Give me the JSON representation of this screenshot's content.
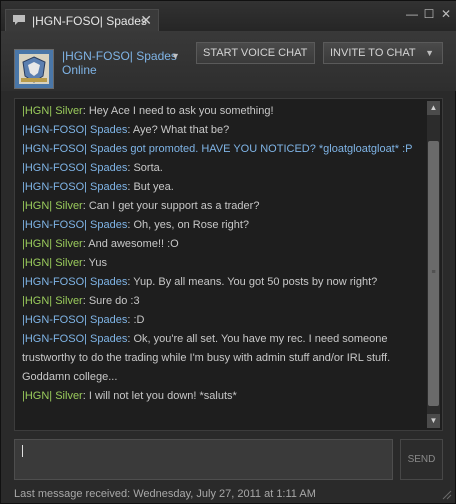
{
  "window": {
    "tab_title": "|HGN-FOSO| Spades",
    "tab_close": "✕",
    "minimize": "—",
    "maximize": "☐",
    "close": "✕"
  },
  "header": {
    "friend_name": "|HGN-FOSO| Spades",
    "friend_status": "Online",
    "voice_button": "START VOICE CHAT",
    "invite_button": "INVITE TO CHAT"
  },
  "messages": [
    {
      "sender": "|HGN| Silver",
      "text": ": Hey Ace I need to ask you something!",
      "color": "green"
    },
    {
      "sender": "|HGN-FOSO| Spades",
      "text": ": Aye? What that be?",
      "color": "blue"
    },
    {
      "sender": "",
      "text": "|HGN-FOSO| Spades got promoted. HAVE YOU NOTICED? *gloatgloatgloat* :P",
      "color": "system"
    },
    {
      "sender": "|HGN-FOSO| Spades",
      "text": ": Sorta.",
      "color": "blue"
    },
    {
      "sender": "|HGN-FOSO| Spades",
      "text": ": But yea.",
      "color": "blue"
    },
    {
      "sender": "|HGN| Silver",
      "text": ": Can I get your support as a trader?",
      "color": "green"
    },
    {
      "sender": "|HGN-FOSO| Spades",
      "text": ": Oh, yes, on Rose right?",
      "color": "blue"
    },
    {
      "sender": "|HGN| Silver",
      "text": ": And awesome!! :O",
      "color": "green"
    },
    {
      "sender": "|HGN| Silver",
      "text": ": Yus",
      "color": "green"
    },
    {
      "sender": "|HGN-FOSO| Spades",
      "text": ": Yup. By all means. You got 50 posts by now right?",
      "color": "blue"
    },
    {
      "sender": "|HGN| Silver",
      "text": ": Sure do :3",
      "color": "green"
    },
    {
      "sender": "|HGN-FOSO| Spades",
      "text": ": :D",
      "color": "blue"
    },
    {
      "sender": "|HGN-FOSO| Spades",
      "text": ": Ok, you're all set. You have my rec. I need someone trustworthy to do the trading while I'm busy with admin stuff and/or IRL stuff. Goddamn college...",
      "color": "blue"
    },
    {
      "sender": "|HGN| Silver",
      "text": ": I will not let you down! *saluts*",
      "color": "green"
    }
  ],
  "input": {
    "value": "",
    "send_label": "SEND"
  },
  "footer": {
    "last_message": "Last message received: Wednesday, July 27, 2011 at 1:11 AM"
  },
  "colors": {
    "friend_blue": "#7fb4e6",
    "silver_green": "#9acb5c",
    "background": "#2a2a2a"
  }
}
